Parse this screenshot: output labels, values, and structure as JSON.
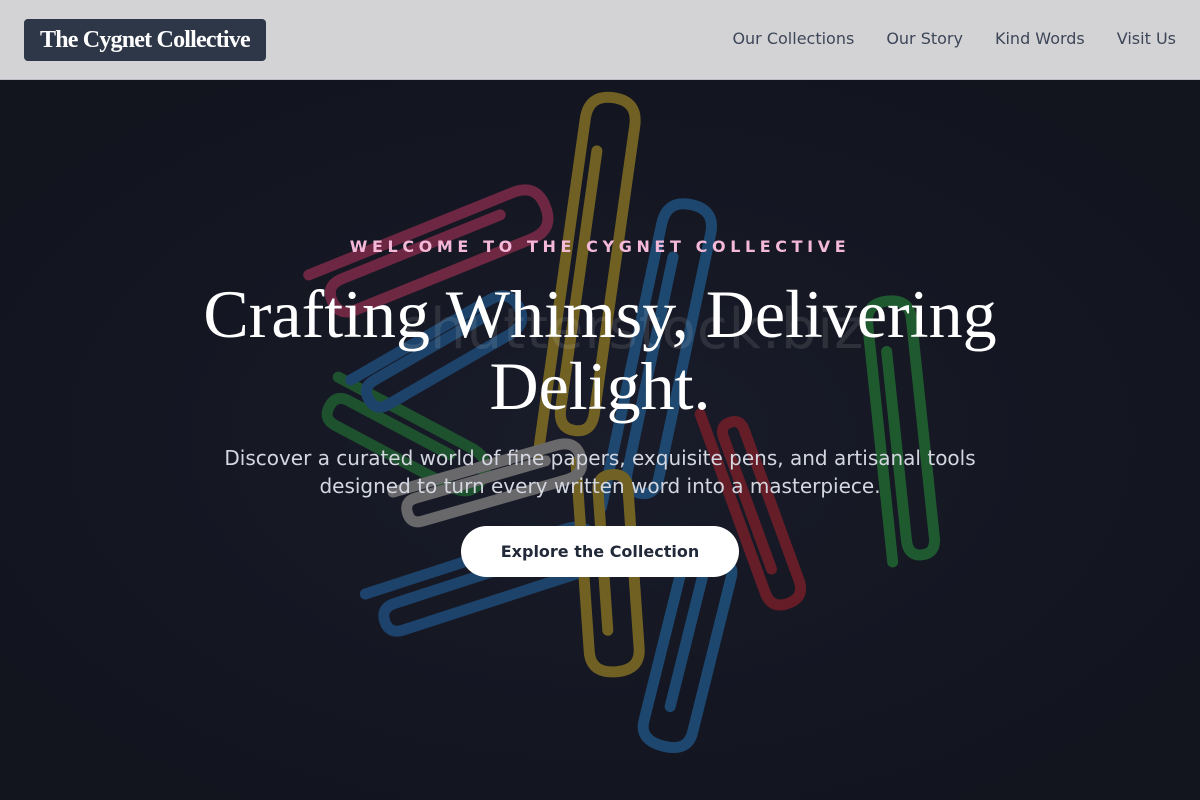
{
  "brand": {
    "name": "The Cygnet Collective"
  },
  "nav": {
    "items": [
      {
        "label": "Our Collections"
      },
      {
        "label": "Our Story"
      },
      {
        "label": "Kind Words"
      },
      {
        "label": "Visit Us"
      }
    ]
  },
  "hero": {
    "eyebrow": "WELCOME TO THE CYGNET COLLECTIVE",
    "headline": "Crafting Whimsy, Delivering Delight.",
    "subtext": "Discover a curated world of fine papers, exquisite pens, and artisanal tools designed to turn every written word into a masterpiece.",
    "cta_label": "Explore the Collection",
    "watermark": "shutterstock.biz"
  },
  "colors": {
    "nav_background": "#d3d3d5",
    "logo_background": "#2e3748",
    "eyebrow_accent": "#f4b8d8",
    "hero_background": "#171924",
    "cta_background": "#ffffff"
  },
  "icons": {
    "hero_image": "paperclips-photo"
  }
}
